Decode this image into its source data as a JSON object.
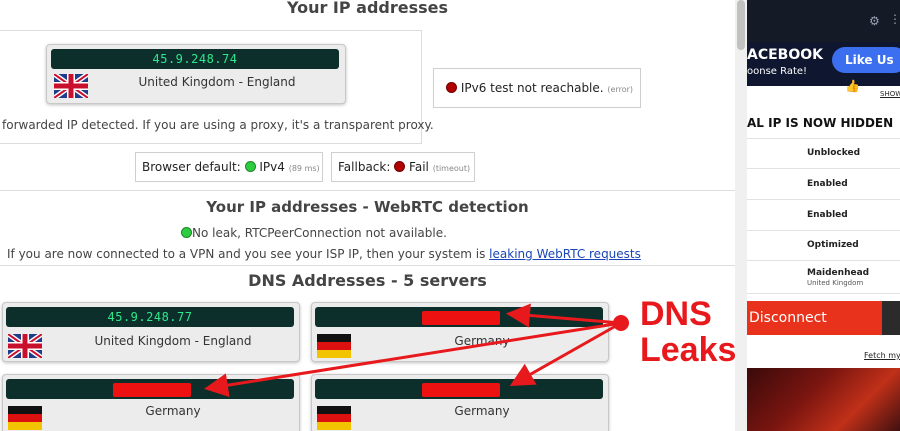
{
  "ip_section": {
    "title": "Your IP addresses",
    "ip": "45.9.248.74",
    "location": "United Kingdom - England",
    "ipv6_text": "IPv6 test not reachable.",
    "ipv6_note": "(error)",
    "forwarded_text": "forwarded IP detected. If you are using a proxy, it's a transparent proxy.",
    "browser_default_label": "Browser default:",
    "browser_default_value": "IPv4",
    "browser_default_time": "(89 ms)",
    "fallback_label": "Fallback:",
    "fallback_value": "Fail",
    "fallback_note": "(timeout)"
  },
  "webrtc_section": {
    "title": "Your IP addresses - WebRTC detection",
    "status": "No leak, RTCPeerConnection not available.",
    "info_prefix": "If you are now connected to a VPN and you see your ISP IP, then your system is",
    "info_link": "leaking WebRTC requests"
  },
  "dns_section": {
    "title": "DNS Addresses - 5 servers",
    "servers": [
      {
        "ip": "45.9.248.77",
        "location": "United Kingdom - England",
        "flag": "uk"
      },
      {
        "ip": "",
        "location": "Germany",
        "flag": "de"
      },
      {
        "ip": "",
        "location": "Germany",
        "flag": "de"
      },
      {
        "ip": "",
        "location": "Germany",
        "flag": "de"
      }
    ]
  },
  "vpn_app": {
    "banner_line1": "ACEBOOK",
    "banner_line2": "oonse Rate!",
    "like_label": "Like Us",
    "show_label": "SHOW",
    "headline": "AL IP IS NOW HIDDEN",
    "rows": [
      {
        "value": "Unblocked"
      },
      {
        "value": "Enabled"
      },
      {
        "value": "Enabled"
      },
      {
        "value": "Optimized"
      },
      {
        "value": "Maidenhead",
        "sub": "United Kingdom"
      }
    ],
    "disconnect_label": "Disconnect",
    "fetch_label": "Fetch my"
  },
  "annotation": {
    "line1": "DNS",
    "line2": "Leaks",
    "color": "#e8191c"
  },
  "colors": {
    "lcd_bg": "#0c2f2c",
    "lcd_text": "#2ee98c",
    "status_green": "#2ecc40",
    "status_red": "#b00000",
    "link": "#1a45b8",
    "disconnect": "#e8321c"
  }
}
